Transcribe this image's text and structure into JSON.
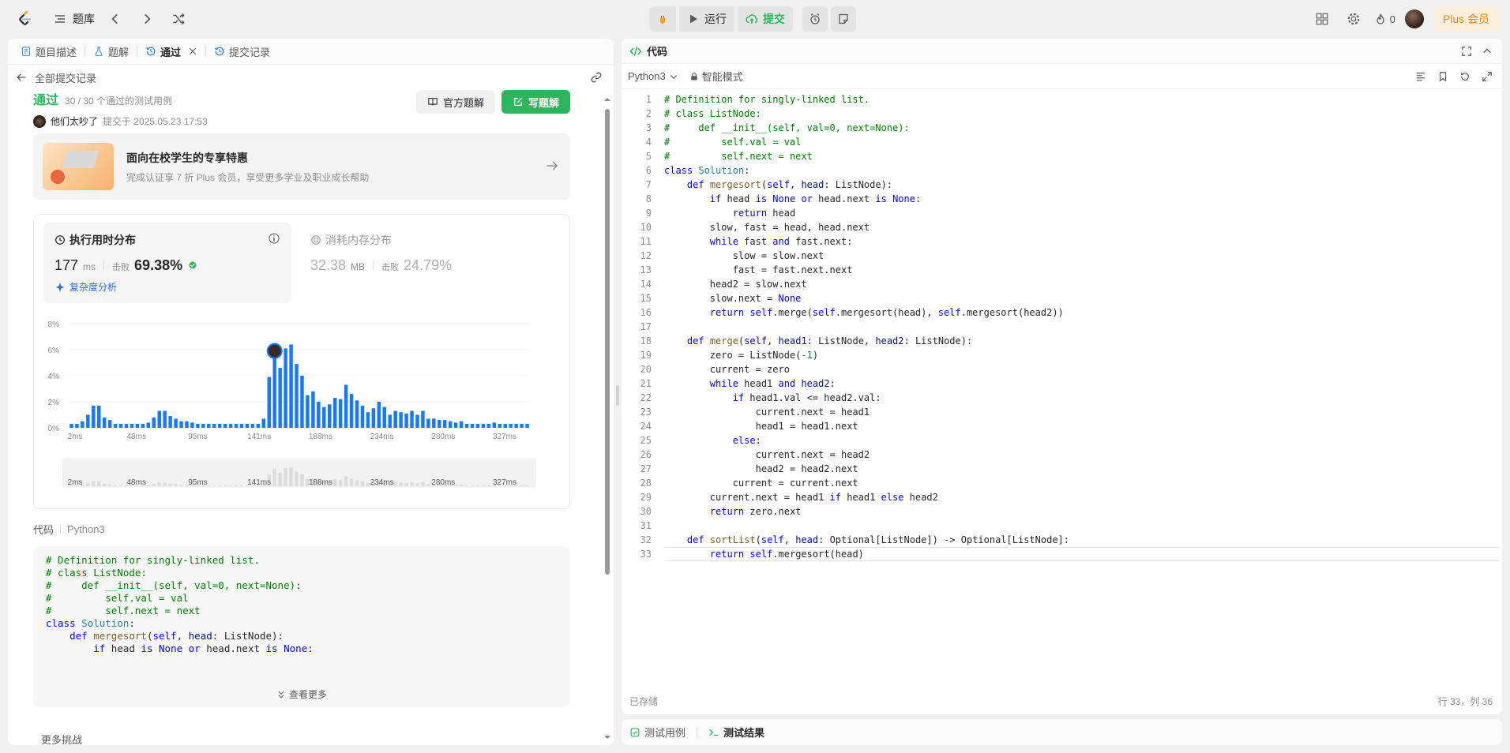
{
  "topbar": {
    "problem_bank": "题库",
    "run": "运行",
    "submit": "提交",
    "fire_count": "0",
    "plus": "Plus 会员"
  },
  "left": {
    "tabs": [
      {
        "label": "题目描述",
        "icon": "description-icon"
      },
      {
        "label": "题解",
        "icon": "flask-icon"
      },
      {
        "label": "通过",
        "icon": "history-icon"
      },
      {
        "label": "提交记录",
        "icon": "history-icon"
      }
    ],
    "back_label": "全部提交记录",
    "status": "通过",
    "status_sub": "30 / 30 个通过的测试用例",
    "user": "他们太吵了",
    "submitted_at": "提交于 2025.05.23 17:53",
    "official_solution": "官方题解",
    "write_solution": "写题解",
    "promo_title": "面向在校学生的专享特惠",
    "promo_sub": "完成认证享 7 折 Plus 会员，享受更多学业及职业成长帮助",
    "runtime_title": "执行用时分布",
    "runtime_value": "177",
    "runtime_unit": "ms",
    "beat_label": "击败",
    "runtime_pct": "69.38%",
    "complexity": "复杂度分析",
    "memory_title": "消耗内存分布",
    "memory_value": "32.38",
    "memory_unit": "MB",
    "memory_pct": "24.79%",
    "code_label": "代码",
    "code_lang": "Python3",
    "code_preview": [
      "# Definition for singly-linked list.",
      "# class ListNode:",
      "#     def __init__(self, val=0, next=None):",
      "#         self.val = val",
      "#         self.next = next",
      "class Solution:",
      "    def mergesort(self, head: ListNode):",
      "        if head is None or head.next is None:"
    ],
    "see_more": "查看更多",
    "more_challenges": "更多挑战"
  },
  "chart_data": {
    "type": "bar",
    "ylim": [
      0,
      8
    ],
    "yticks": [
      "0%",
      "2%",
      "4%",
      "6%",
      "8%"
    ],
    "xticks": [
      "2ms",
      "48ms",
      "95ms",
      "141ms",
      "188ms",
      "234ms",
      "280ms",
      "327ms"
    ],
    "values": [
      0.3,
      0.3,
      0.5,
      1.0,
      1.7,
      1.7,
      0.8,
      0.6,
      0.3,
      0.3,
      0.3,
      0.3,
      0.3,
      0.3,
      0.4,
      0.8,
      1.3,
      1.3,
      0.9,
      0.7,
      0.5,
      0.5,
      0.4,
      0.3,
      0.3,
      0.3,
      0.3,
      0.3,
      0.3,
      0.3,
      0.3,
      0.3,
      0.3,
      0.3,
      0.3,
      0.7,
      3.9,
      5.9,
      4.6,
      6.1,
      6.4,
      4.9,
      4.0,
      2.5,
      2.8,
      2.0,
      1.6,
      1.8,
      2.3,
      2.2,
      3.3,
      2.6,
      2.1,
      1.7,
      1.2,
      1.5,
      2.0,
      1.6,
      1.0,
      1.3,
      1.2,
      1.1,
      1.3,
      1.0,
      1.3,
      0.7,
      0.7,
      0.6,
      0.6,
      0.5,
      0.4,
      0.5,
      0.3,
      0.3,
      0.3,
      0.3,
      0.3,
      0.4,
      0.3,
      0.3,
      0.3,
      0.3,
      0.3,
      0.3
    ],
    "highlight_index": 37,
    "bar_color": "#1677ff"
  },
  "right": {
    "title": "代码",
    "lang": "Python3",
    "mode": "智能模式",
    "saved": "已存储",
    "cursor": "行 33，列 36",
    "code_lines": [
      "# Definition for singly-linked list.",
      "# class ListNode:",
      "#     def __init__(self, val=0, next=None):",
      "#         self.val = val",
      "#         self.next = next",
      "class Solution:",
      "    def mergesort(self, head: ListNode):",
      "        if head is None or head.next is None:",
      "            return head",
      "        slow, fast = head, head.next",
      "        while fast and fast.next:",
      "            slow = slow.next",
      "            fast = fast.next.next",
      "        head2 = slow.next",
      "        slow.next = None",
      "        return self.merge(self.mergesort(head), self.mergesort(head2))",
      "",
      "    def merge(self, head1: ListNode, head2: ListNode):",
      "        zero = ListNode(-1)",
      "        current = zero",
      "        while head1 and head2:",
      "            if head1.val <= head2.val:",
      "                current.next = head1",
      "                head1 = head1.next",
      "            else:",
      "                current.next = head2",
      "                head2 = head2.next",
      "            current = current.next",
      "        current.next = head1 if head1 else head2",
      "        return zero.next",
      "",
      "    def sortList(self, head: Optional[ListNode]) -> Optional[ListNode]:",
      "        return self.mergesort(head)"
    ]
  },
  "bottom": {
    "tabs": [
      "测试用例",
      "测试结果"
    ]
  }
}
